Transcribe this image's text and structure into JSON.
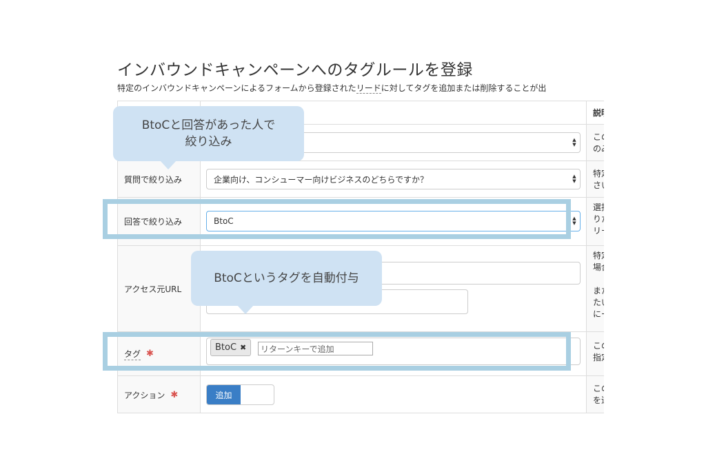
{
  "page": {
    "title": "インバウンドキャンペーンへのタグルールを登録",
    "description_before": "特定のインバウンドキャンペーンによるフォームから登録された",
    "description_link": "リード",
    "description_after": "に対してタグを追加または削除することが出"
  },
  "table": {
    "header_desc": "説明",
    "rows": {
      "campaign": {
        "desc_line1": "この",
        "desc_line2": "のみ"
      },
      "question": {
        "label": "質問で絞り込み",
        "select_value": "企業向け、コンシューマー向けビジネスのどちらですか？",
        "desc_line1": "特定",
        "desc_line2": "さい"
      },
      "answer": {
        "label": "回答で絞り込み",
        "select_value": "BtoC",
        "desc_line1": "選択",
        "desc_line2": "りた",
        "desc_line3": "リー"
      },
      "url": {
        "label": "アクセス元URL",
        "desc_line1": "特定",
        "desc_line2": "場合",
        "desc_line3": "また",
        "desc_line4": "たい",
        "desc_line5": "にー"
      },
      "tag": {
        "label": "タグ",
        "chip": "BtoC",
        "chip_remove": "✖",
        "input_placeholder": "リターンキーで追加",
        "desc_line1": "この",
        "desc_line2": "指定"
      },
      "action": {
        "label": "アクション",
        "toggle_on": "追加",
        "desc_line1": "この",
        "desc_line2": "を追"
      }
    },
    "required_mark": "✱"
  },
  "callouts": {
    "answer_line1": "BtoCと回答があった人で",
    "answer_line2": "絞り込み",
    "tag": "BtoCというタグを自動付与"
  },
  "colors": {
    "highlight": "#a9cfe2",
    "bubble": "#cfe2f3",
    "toggle_on": "#3a7ec6",
    "required": "#d9534f"
  }
}
